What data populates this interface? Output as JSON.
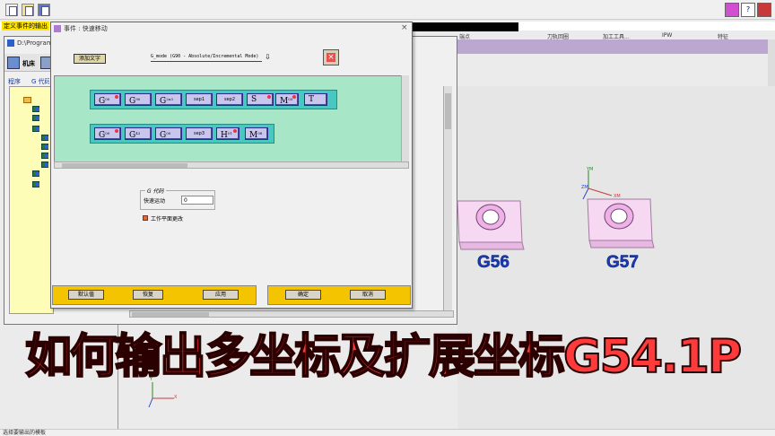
{
  "topbar": {
    "config_label": "定义事件的输出",
    "col_labels": [
      "端点",
      "刀轨回圈",
      "加工工具...",
      "IPW",
      "特征"
    ]
  },
  "backwin": {
    "title": "D:\\Program",
    "tab_machine": "机床",
    "tab_program": "程序",
    "tab_gcode": "G 代码"
  },
  "event_dialog": {
    "title": "事件 : 快速移动",
    "add_text_label": "添加文字",
    "mode_select_value": "G_mode (G90 - Absolute/Incremental Mode)"
  },
  "block_row1": [
    {
      "code": "G",
      "sub": "00",
      "dot": true
    },
    {
      "code": "G",
      "sub": "90",
      "dot": false
    },
    {
      "code": "G",
      "sub": "2n3",
      "dot": false
    },
    {
      "code": "sep1",
      "sub": "",
      "dot": false
    },
    {
      "code": "sep2",
      "sub": "",
      "dot": false
    },
    {
      "code": "S",
      "sub": "",
      "dot": true
    },
    {
      "code": "M",
      "sub": "03",
      "dot": true
    },
    {
      "code": "T",
      "sub": "",
      "dot": false
    }
  ],
  "block_row2": [
    {
      "code": "G",
      "sub": "00",
      "dot": true
    },
    {
      "code": "G",
      "sub": "43",
      "dot": false
    },
    {
      "code": "G",
      "sub": "00",
      "dot": false
    },
    {
      "code": "sep3",
      "sub": "",
      "dot": false
    },
    {
      "code": "H",
      "sub": "01",
      "dot": true
    },
    {
      "code": "M",
      "sub": "08",
      "dot": false
    }
  ],
  "gcode_group": {
    "title": "G 代码",
    "rapid_label": "快速运动",
    "rapid_value": "0",
    "work_plane_label": "工作平面更改"
  },
  "buttons": {
    "default": "默认值",
    "restore": "恢复",
    "apply": "应用",
    "ok": "确定",
    "cancel": "取消"
  },
  "viewport": {
    "label_g56": "G56",
    "label_g57": "G57",
    "axis_x": "X",
    "axis_y": "Y",
    "axis_xm": "XM",
    "axis_ym": "YM",
    "axis_zm": "ZM"
  },
  "overlay_caption": "如何输出多坐标及扩展坐标G54.1P",
  "status_text": "选择要输出的模板"
}
